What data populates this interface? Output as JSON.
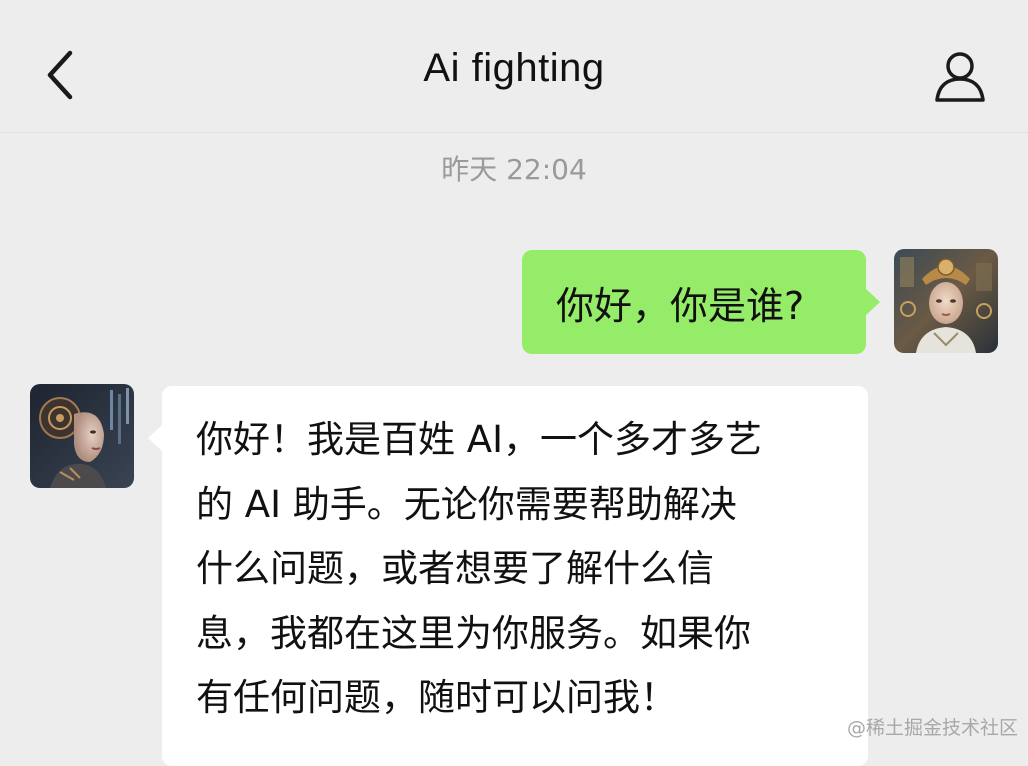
{
  "header": {
    "title": "Ai fighting",
    "back_icon": "chevron-left-icon",
    "profile_icon": "person-icon"
  },
  "chat": {
    "timestamp": "昨天 22:04",
    "messages": [
      {
        "sender": "me",
        "avatar": "robot-woman-avatar",
        "text": "你好，你是谁?"
      },
      {
        "sender": "ai",
        "avatar": "robot-woman-avatar",
        "lines": [
          "你好！我是百姓 AI，一个多才多艺",
          "的 AI 助手。无论你需要帮助解决",
          "什么问题，或者想要了解什么信",
          "息，我都在这里为你服务。如果你",
          "有任何问题，随时可以问我！"
        ]
      }
    ]
  },
  "watermark": "@稀土掘金技术社区",
  "colors": {
    "background": "#ededed",
    "sent_bubble": "#95ec69",
    "received_bubble": "#ffffff",
    "timestamp_text": "#9a9a9a"
  }
}
